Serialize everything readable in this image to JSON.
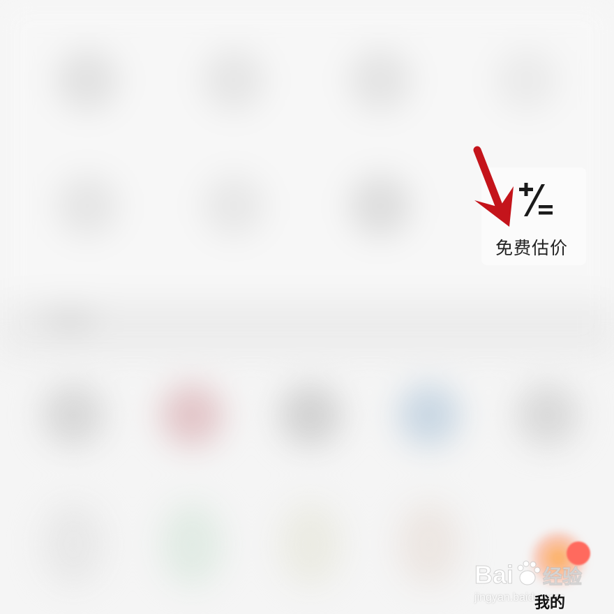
{
  "estimate": {
    "icon": "calculator-plus-slash-equals-icon",
    "label": "免费估价"
  },
  "annotation": {
    "icon": "red-arrow-icon",
    "color": "#c4141b"
  },
  "watermark": {
    "logo_text": "Bai 经验",
    "url_text": "jingyan.baidu.com"
  },
  "tab_bar": {
    "mine_label": "我的",
    "accent_color": "#ff6a5e"
  }
}
